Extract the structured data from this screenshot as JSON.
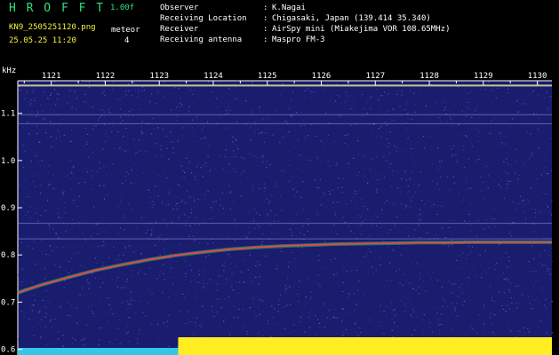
{
  "header": {
    "app_title": "H R O F F T",
    "version": "1.00f",
    "file_name": "KN9_2505251120.png",
    "datetime": "25.05.25 11:20",
    "mode_label": "meteor",
    "mode_value": "4",
    "info_rows": [
      {
        "label": "Observer",
        "value": "K.Nagai"
      },
      {
        "label": "Receiving Location",
        "value": "Chigasaki, Japan (139.414 35.340)"
      },
      {
        "label": "Receiver",
        "value": "AirSpy mini (Miakejima VOR 108.65MHz)"
      },
      {
        "label": "Receiving antenna",
        "value": "Maspro FM-3"
      }
    ],
    "colors": {
      "title": "#2ee07a",
      "file": "#f4f43a",
      "label": "#ffffff",
      "value": "#8fe8e8"
    }
  },
  "chart_data": {
    "type": "heatmap",
    "ylabel": "kHz",
    "y_ticks": [
      "1.1",
      "1.0",
      "0.9",
      "0.8",
      "0.7",
      "0.6"
    ],
    "y_tick_values": [
      1.1,
      1.0,
      0.9,
      0.8,
      0.7,
      0.6
    ],
    "x_ticks": [
      "1121",
      "1122",
      "1123",
      "1124",
      "1125",
      "1126",
      "1127",
      "1128",
      "1129",
      "1130"
    ],
    "x_tick_values": [
      1121,
      1122,
      1123,
      1124,
      1125,
      1126,
      1127,
      1128,
      1129,
      1130
    ],
    "xlim": [
      1120.38,
      1130.27
    ],
    "ylim": [
      0.588,
      1.169
    ],
    "grid": false,
    "background_color": "#1a1c6e",
    "horizontal_lines_khz": [
      1.159,
      1.097,
      1.078,
      0.867,
      0.834
    ],
    "doppler_trace": {
      "x": [
        1120.38,
        1120.8,
        1121.3,
        1121.8,
        1122.3,
        1122.8,
        1123.3,
        1123.8,
        1124.3,
        1124.8,
        1125.3,
        1125.8,
        1126.3,
        1126.8,
        1127.3,
        1127.8,
        1128.3,
        1128.8,
        1129.3,
        1129.8,
        1130.27
      ],
      "y": [
        0.72,
        0.736,
        0.752,
        0.767,
        0.779,
        0.79,
        0.799,
        0.806,
        0.812,
        0.816,
        0.819,
        0.821,
        0.823,
        0.824,
        0.825,
        0.826,
        0.826,
        0.827,
        0.827,
        0.827,
        0.827
      ],
      "color": "#ff4040"
    },
    "bottom_bar": {
      "segments": [
        {
          "x0": 1120.38,
          "x1": 1123.35,
          "color": "#33c6e8"
        },
        {
          "x0": 1123.35,
          "x1": 1130.27,
          "color": "#ffee22"
        }
      ]
    }
  }
}
